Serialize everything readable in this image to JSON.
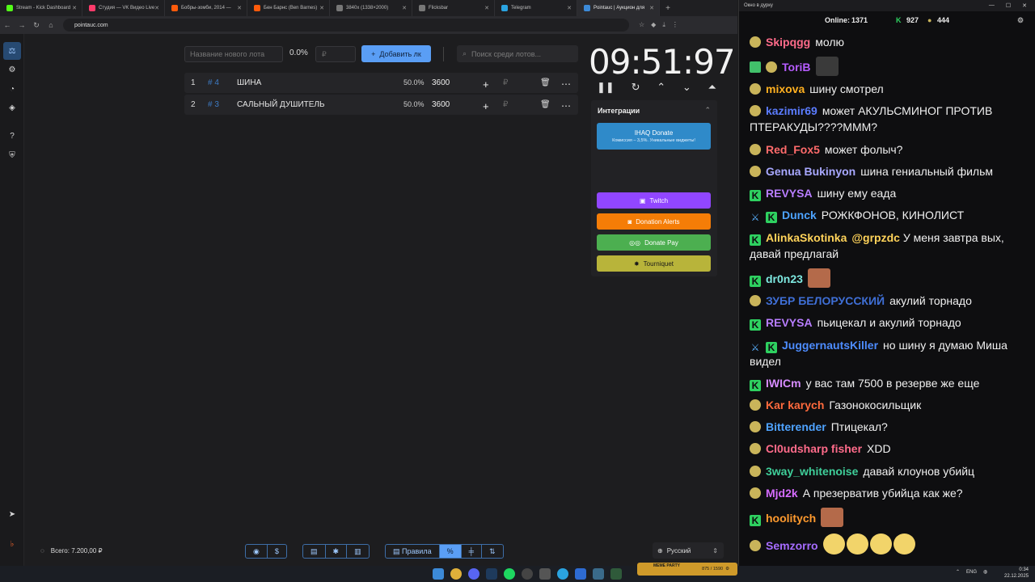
{
  "browser": {
    "tabs": [
      {
        "label": "Stream - Kick Dashboard",
        "color": "#53fc18"
      },
      {
        "label": "Студия — VK Видео Live",
        "color": "#ff3b6b"
      },
      {
        "label": "Бобры-зомби, 2014 —",
        "color": "#ff5b0b"
      },
      {
        "label": "Бен Барнс (Ben Barnes)",
        "color": "#ff5b0b"
      },
      {
        "label": "3840x (1338×2000)",
        "color": "#777777"
      },
      {
        "label": "Flicksbar",
        "color": "#777777"
      },
      {
        "label": "Telegram",
        "color": "#2aa3e0"
      },
      {
        "label": "Pointauc | Аукцион для",
        "color": "#3c8ad8"
      }
    ],
    "url": "pointauc.com"
  },
  "auction": {
    "new_lot_placeholder": "Название нового лота",
    "percent": "0.0%",
    "currency_placeholder": "₽",
    "add_button": "Добавить лк",
    "search_placeholder": "Поиск среди лотов...",
    "lots": [
      {
        "index": "1",
        "id": "# 4",
        "name": "ШИНА",
        "percent": "50.0%",
        "amount": "3600",
        "currency": "₽"
      },
      {
        "index": "2",
        "id": "# 3",
        "name": "САЛЬНЫЙ ДУШИТЕЛЬ",
        "percent": "50.0%",
        "amount": "3600",
        "currency": "₽"
      }
    ],
    "timer": "09:51:97",
    "total": "Всего: 7.200,00 ₽",
    "footer": {
      "rules": "Правила",
      "language": "Русский"
    }
  },
  "integrations": {
    "title": "Интеграции",
    "ihaq": "IHAQ Donate",
    "ihaq_sub": "Комиссия – 3,5%. Уникальные виджеты!",
    "twitch": "Twitch",
    "donation_alerts": "Donation Alerts",
    "donate_pay": "Donate Pay",
    "tourniquet": "Tourniquet"
  },
  "chat": {
    "window_title": "Окно в дурку",
    "online_label": "Online:",
    "online_value": "1371",
    "kick_count": "927",
    "other_count": "444",
    "messages": [
      {
        "user": "Skipqgg",
        "color": "#ff6b8a",
        "text": "молю"
      },
      {
        "user": "ToriB",
        "color": "#b65cff",
        "text": ""
      },
      {
        "user": "mixova",
        "color": "#ffb020",
        "text": "шину смотрел"
      },
      {
        "user": "kazimir69",
        "color": "#5b7cff",
        "text": "может АКУЛЬСМИНОГ ПРОТИВ ПТЕРАКУДЫ????МММ?"
      },
      {
        "user": "Red_Fox5",
        "color": "#ff6b6b",
        "text": "может фолыч?"
      },
      {
        "user": "Genua Bukinyon",
        "color": "#a8a8ff",
        "text": "шина гениальный фильм"
      },
      {
        "user": "REVYSA",
        "color": "#b87dff",
        "text": "шину ему еада"
      },
      {
        "user": "Dunck",
        "color": "#4da3ff",
        "text": "РОЖКФОНОВ, КИНОЛИСТ"
      },
      {
        "user": "AlinkaSkotinka",
        "color": "#ffd35a",
        "text": "У меня завтра вых, давай предлагай",
        "mention": "@grpzdc"
      },
      {
        "user": "dr0n23",
        "color": "#7ee8e0",
        "text": ""
      },
      {
        "user": "ЗУБР БЕЛОРУССКИЙ",
        "color": "#3f6fd6",
        "text": "акулий торнадо"
      },
      {
        "user": "REVYSA",
        "color": "#b87dff",
        "text": "пьицекал и акулий торнадо"
      },
      {
        "user": "JuggernautsKiller",
        "color": "#4d8cff",
        "text": "но шину я думаю Миша видел"
      },
      {
        "user": "IWICm",
        "color": "#d78cff",
        "text": "у вас там 7500 в резерве же еще"
      },
      {
        "user": "Kar karych",
        "color": "#ff6a3d",
        "text": "Газонокосильщик"
      },
      {
        "user": "Bitterender",
        "color": "#4fa3ff",
        "text": "Птицекал?"
      },
      {
        "user": "Cl0udsharp fisher",
        "color": "#ff6b8a",
        "text": "XDD"
      },
      {
        "user": "3way_whitenoise",
        "color": "#3fcf9a",
        "text": "давай клоунов убийц"
      },
      {
        "user": "Mjd2k",
        "color": "#d66cff",
        "text": "А презерватив убийца как же?"
      },
      {
        "user": "hoolitych",
        "color": "#ff9a2e",
        "text": ""
      },
      {
        "user": "Semzorro",
        "color": "#a66cff",
        "text": ""
      }
    ]
  },
  "taskbar": {
    "game": "MEME PARTY",
    "game_stat": "875 / 1590",
    "lang": "ENG",
    "time": "0:34",
    "date": "22.12.2025"
  }
}
